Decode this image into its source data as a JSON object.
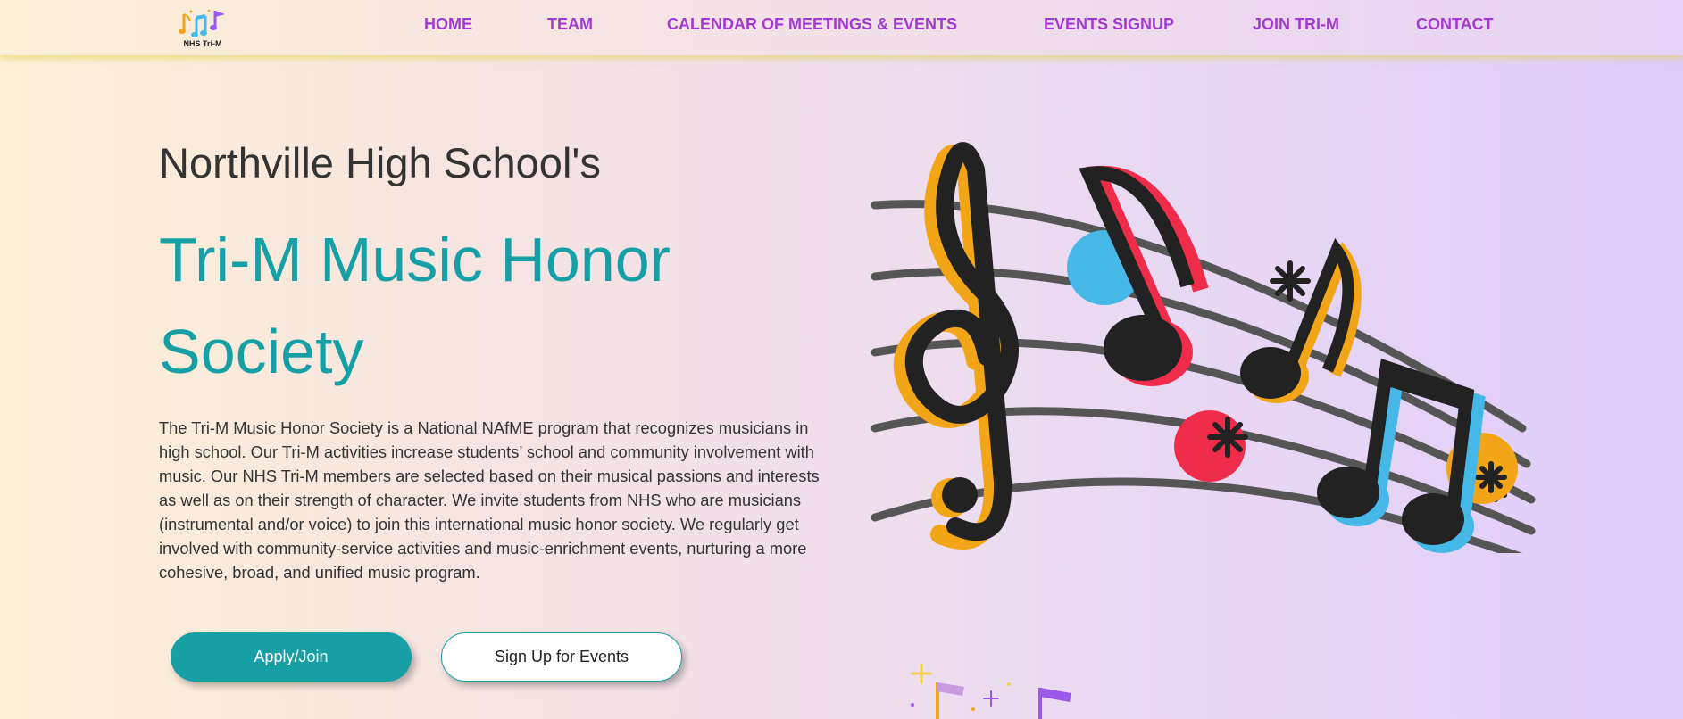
{
  "nav": {
    "logo_text": "NHS Tri-M",
    "links": [
      {
        "label": "HOME"
      },
      {
        "label": "TEAM"
      },
      {
        "label": "CALENDAR OF MEETINGS & EVENTS"
      },
      {
        "label": "EVENTS SIGNUP"
      },
      {
        "label": "JOIN TRI-M"
      },
      {
        "label": "CONTACT"
      }
    ]
  },
  "hero": {
    "subtitle": "Northville High School's",
    "title": "Tri-M Music Honor Society",
    "description": "The Tri-M Music Honor Society is a National NAfME program that recognizes musicians in high school. Our Tri-M activities increase students’ school and community involvement with music. Our NHS Tri-M members are selected based on their musical passions and interests as well as on their strength of character. We invite students from NHS who are musicians (instrumental and/or voice) to join this international music honor society. We regularly get involved with community-service activities and music-enrichment events, nurturing a more cohesive, broad, and unified music program.",
    "buttons": {
      "apply": "Apply/Join",
      "signup": "Sign Up for Events"
    }
  },
  "colors": {
    "accent_teal": "#16a0a6",
    "nav_purple": "#a13bd0",
    "note_orange": "#f2a516",
    "note_blue": "#45b8e8",
    "note_red": "#ef2d4a"
  },
  "icons": [
    "music-notes-logo-icon",
    "music-notes-illustration",
    "music-notes-decoration"
  ]
}
